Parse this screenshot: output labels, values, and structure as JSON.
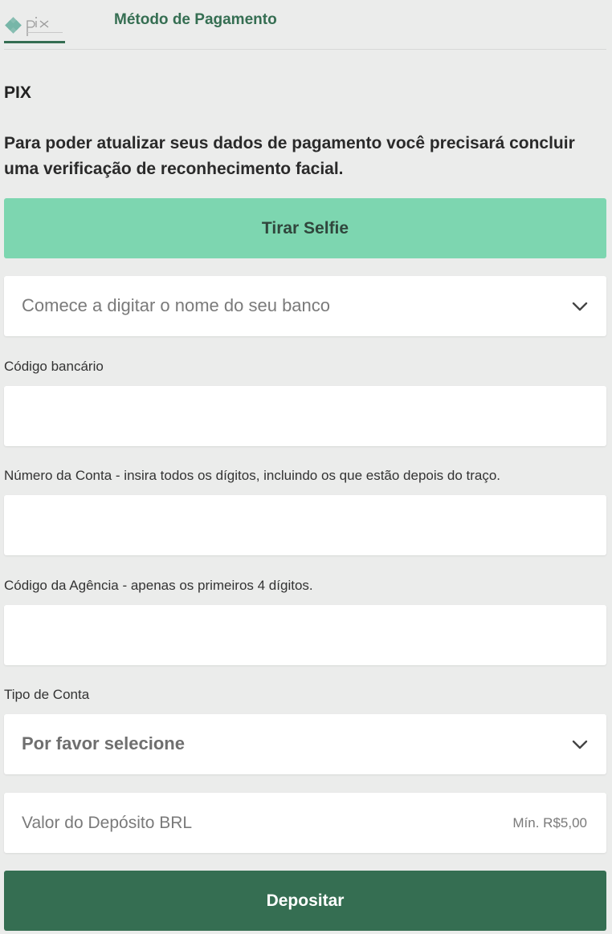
{
  "tabs": {
    "logo_name": "pix-logo",
    "active_title": "Método de Pagamento"
  },
  "section_title": "PIX",
  "notice": "Para poder atualizar seus dados de pagamento você precisará concluir uma verificação de reconhecimento facial.",
  "selfie_button": "Tirar Selfie",
  "bank_select": {
    "placeholder": "Comece a digitar o nome do seu banco"
  },
  "bank_code": {
    "label": "Código bancário",
    "value": ""
  },
  "account_number": {
    "label": "Número da Conta - insira todos os dígitos, incluindo os que estão depois do traço.",
    "value": ""
  },
  "agency_code": {
    "label": "Código da Agência - apenas os primeiros 4 dígitos.",
    "value": ""
  },
  "account_type": {
    "label": "Tipo de Conta",
    "selected": "Por favor selecione"
  },
  "deposit_amount": {
    "placeholder": "Valor do Depósito BRL",
    "min_hint": "Mín. R$5,00"
  },
  "deposit_button": "Depositar",
  "colors": {
    "background": "#ebeceb",
    "accent_dark": "#356e52",
    "accent_light": "#7dd6b0",
    "pix_logo": "#77b6a8"
  }
}
